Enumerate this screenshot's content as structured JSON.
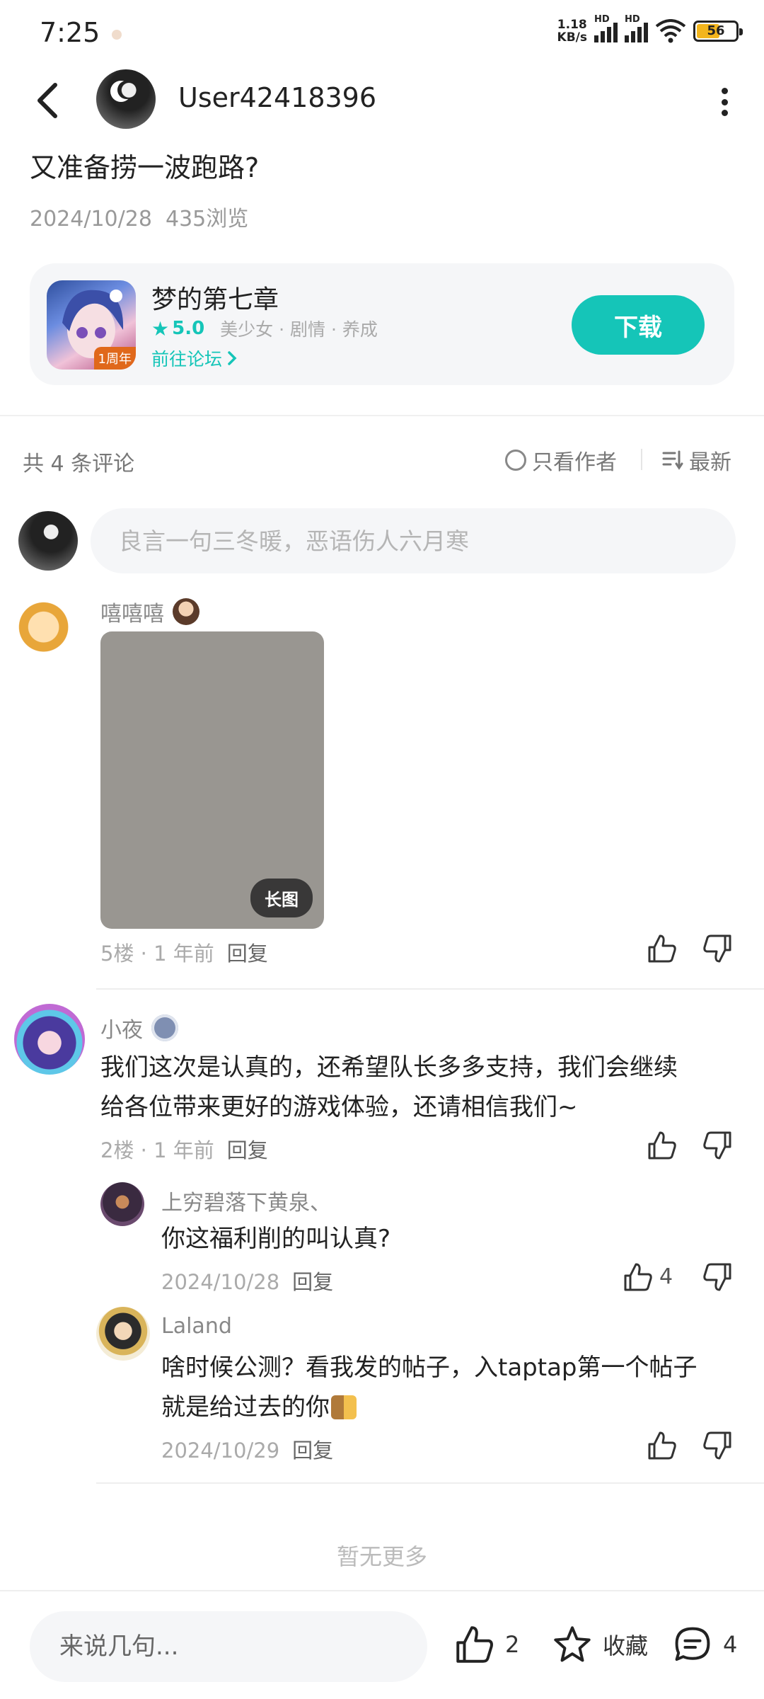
{
  "status": {
    "time": "7:25",
    "net_speed_line1": "1.18",
    "net_speed_line2": "KB/s",
    "hd_label": "HD",
    "battery": "56"
  },
  "header": {
    "username": "User42418396"
  },
  "post": {
    "title": "又准备捞一波跑路?",
    "date": "2024/10/28",
    "views": "435浏览"
  },
  "game": {
    "name": "梦的第七章",
    "score": "5.0",
    "tags": "美少女 · 剧情 · 养成",
    "forum_link": "前往论坛",
    "icon_tag": "1周年",
    "download_label": "下载"
  },
  "comments_header": {
    "count_text": "共 4 条评论",
    "author_only": "只看作者",
    "sort": "最新"
  },
  "comment_input": {
    "placeholder": "良言一句三冬暖，恶语伤人六月寒"
  },
  "comments": [
    {
      "name": "嘻嘻嘻",
      "image_badge": "长图",
      "floor": "5楼",
      "time": "1 年前",
      "reply": "回复"
    },
    {
      "name": "小夜",
      "text_line1": "我们这次是认真的，还希望队长多多支持，我们会继续",
      "text_line2": "给各位带来更好的游戏体验，还请相信我们~",
      "floor": "2楼",
      "time": "1 年前",
      "reply": "回复",
      "replies": [
        {
          "name": "上穷碧落下黄泉、",
          "text": "你这福利削的叫认真?",
          "date": "2024/10/28",
          "reply": "回复",
          "likes": "4"
        },
        {
          "name": "Laland",
          "text_line1": "啥时候公测？看我发的帖子，入taptap第一个帖子",
          "text_line2": "就是给过去的你",
          "date": "2024/10/29",
          "reply": "回复"
        }
      ]
    }
  ],
  "footer": {
    "no_more": "暂无更多"
  },
  "bottom_bar": {
    "placeholder": "来说几句...",
    "likes": "2",
    "favorite": "收藏",
    "comments": "4"
  },
  "colors": {
    "accent": "#15c5b8"
  }
}
